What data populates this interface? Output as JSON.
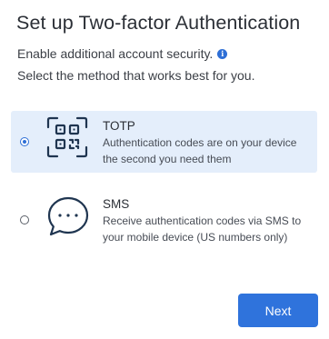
{
  "dialog": {
    "title": "Set up Two-factor Authentication",
    "subtitle": "Enable additional account security.",
    "info_icon": "info-icon",
    "instruction": "Select the method that works best for you."
  },
  "options": [
    {
      "name": "TOTP",
      "description": "Authentication codes are on your device the second you need them",
      "icon": "qr-code-scan-icon",
      "selected": true
    },
    {
      "name": "SMS",
      "description": "Receive authentication codes via SMS to your mobile device (US numbers only)",
      "icon": "chat-bubble-icon",
      "selected": false
    }
  ],
  "actions": {
    "next_label": "Next"
  },
  "colors": {
    "accent": "#2f73dc",
    "selected_background": "#e4eefb",
    "text": "#2b2f36"
  }
}
